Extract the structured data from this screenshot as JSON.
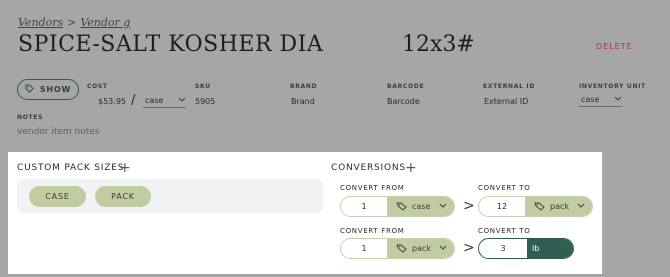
{
  "breadcrumb": {
    "parent": "Vendors",
    "separator": ">",
    "current": "Vendor g"
  },
  "title": "SPICE-SALT KOSHER DIA",
  "title_size": "12x3#",
  "delete_label": "DELETE",
  "show_button": {
    "label": "SHOW",
    "icon": "tag-icon"
  },
  "fields": {
    "cost": {
      "label": "COST",
      "value": "$53.95",
      "unit": "case"
    },
    "sku": {
      "label": "SKU",
      "value": "5905"
    },
    "brand": {
      "label": "BRAND",
      "value": "Brand"
    },
    "barcode": {
      "label": "BARCODE",
      "value": "Barcode"
    },
    "external_id": {
      "label": "EXTERNAL ID",
      "value": "External ID"
    },
    "inventory_unit": {
      "label": "INVENTORY UNIT",
      "value": "case"
    }
  },
  "slash": "/",
  "notes": {
    "label": "NOTES",
    "placeholder": "vendor item notes"
  },
  "custom_pack": {
    "title": "CUSTOM PACK SIZES",
    "add": "+",
    "packs": [
      "CASE",
      "PACK"
    ]
  },
  "conversions": {
    "title": "CONVERSIONS",
    "add": "+",
    "from_label": "CONVERT FROM",
    "to_label": "CONVERT TO",
    "arrow": ">",
    "rows": [
      {
        "from_qty": "1",
        "from_unit": "case",
        "to_qty": "12",
        "to_unit": "pack"
      },
      {
        "from_qty": "1",
        "from_unit": "pack",
        "to_qty": "3",
        "to_unit": "lb"
      }
    ]
  },
  "colors": {
    "background": "#a6a6a6",
    "accent_green": "#2f5e52",
    "pill_green": "#c2cca3",
    "delete_red": "#b8322c"
  }
}
